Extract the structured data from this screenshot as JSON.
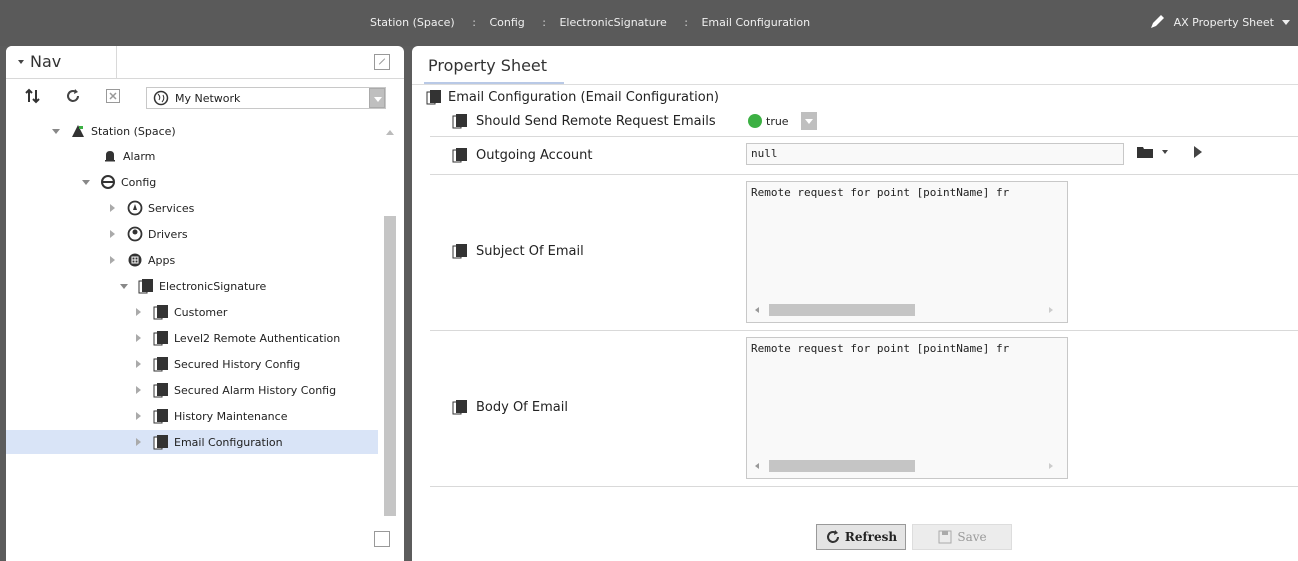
{
  "breadcrumb": {
    "items": [
      "Station (Space)",
      "Config",
      "ElectronicSignature",
      "Email Configuration"
    ],
    "separator": ":"
  },
  "view_selector": {
    "label": "AX Property Sheet",
    "icon": "pencil-icon"
  },
  "nav": {
    "title": "Nav",
    "network": "My Network",
    "tree": [
      {
        "label": "Station (Space)",
        "icon": "station-icon",
        "expanded": true
      },
      {
        "label": "Alarm",
        "icon": "bell-icon"
      },
      {
        "label": "Config",
        "icon": "database-icon",
        "expanded": true
      },
      {
        "label": "Services",
        "icon": "services-icon"
      },
      {
        "label": "Drivers",
        "icon": "drivers-icon"
      },
      {
        "label": "Apps",
        "icon": "apps-icon"
      },
      {
        "label": "ElectronicSignature",
        "icon": "folder-icon",
        "expanded": true
      },
      {
        "label": "Customer",
        "icon": "component-icon"
      },
      {
        "label": "Level2 Remote Authentication",
        "icon": "component-icon"
      },
      {
        "label": "Secured History Config",
        "icon": "component-icon"
      },
      {
        "label": "Secured Alarm History Config",
        "icon": "component-icon"
      },
      {
        "label": "History Maintenance",
        "icon": "component-icon"
      },
      {
        "label": "Email Configuration",
        "icon": "component-icon",
        "selected": true
      }
    ]
  },
  "sheet": {
    "tab": "Property Sheet",
    "root": "Email Configuration  (Email Configuration)",
    "props": {
      "send_remote": {
        "label": "Should Send Remote Request Emails",
        "value": "true"
      },
      "outgoing": {
        "label": "Outgoing Account",
        "value": "null"
      },
      "subject": {
        "label": "Subject Of Email",
        "value": "Remote request for point [pointName] fr"
      },
      "body": {
        "label": "Body Of Email",
        "value": "Remote request for point [pointName] fr"
      }
    },
    "refresh": "Refresh",
    "save": "Save"
  },
  "colors": {
    "selection": "#d9e4f7",
    "true_dot": "#3cb043",
    "tab_underline": "#b9c9e6"
  }
}
